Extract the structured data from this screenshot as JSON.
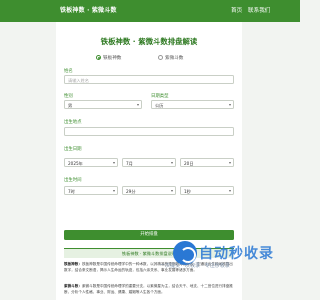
{
  "header": {
    "brand": "铁板神数 · 紫微斗数",
    "nav": [
      "首页",
      "联系我们"
    ]
  },
  "main": {
    "title": "铁板神数 · 紫微斗数排盘解读",
    "mode_options": [
      {
        "label": "铁板神数",
        "selected": true
      },
      {
        "label": "紫微斗数",
        "selected": false
      }
    ],
    "name_label": "姓名",
    "name_placeholder": "请输入姓名",
    "gender_label": "性别",
    "gender_value": "男",
    "calendar_label": "日期类型",
    "calendar_value": "公历",
    "birthplace_label": "出生地点",
    "birthplace_value": "",
    "birthdate_label": "出生日期",
    "year_value": "2025年",
    "month_value": "7月",
    "day_value": "20日",
    "birthtime_label": "出生时间",
    "hour_value": "7时",
    "minute_value": "29分",
    "second_value": "1秒",
    "submit_label": "开始排盘"
  },
  "info": {
    "heading": "铁板神数 · 紫微斗数排盘说明",
    "para1_term": "铁板神数：",
    "para1_text": "铁板神数是中国传统命理学中的一种术数，以其精准的预测能力而闻名。它通过出生时间推算出数字，结合条文断语，揭示人生命运的轨迹，包括六亲关系、事业发展等诸多方面。",
    "para2_term": "紫微斗数：",
    "para2_text": "紫微斗数是中国传统命理学的重要分支，以紫微星为主，结合天干、地支、十二宫位进行排盘推断，分析个人性格、事业、财运、健康、婚姻等人生各个方面。"
  },
  "watermark": {
    "title": "自动秒收录",
    "subtitle": "一次提交一次收录 · 专注秒收录"
  },
  "colors": {
    "accent": "#3e8e2f",
    "background": "#f2f4f1",
    "watermark": "#2a78d4"
  }
}
